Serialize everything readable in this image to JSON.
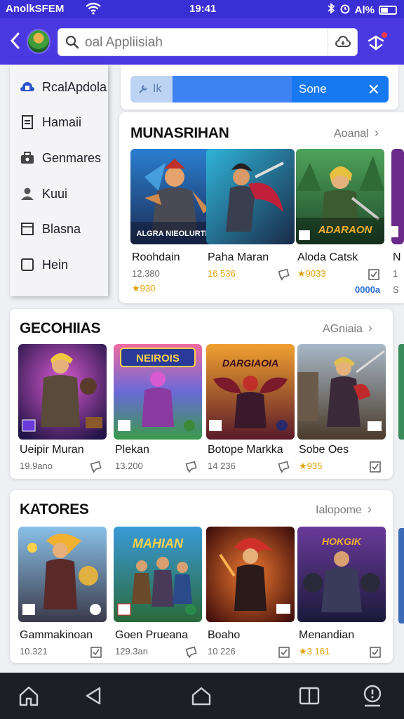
{
  "status": {
    "carrier": "AnolkSFEM",
    "time": "19:41",
    "battery": "Al%"
  },
  "header": {
    "search_placeholder": "oal Appliisiah"
  },
  "drawer": {
    "items": [
      {
        "label": "RcalApdola",
        "icon": "cloud-lock-icon"
      },
      {
        "label": "Hamaii",
        "icon": "document-icon"
      },
      {
        "label": "Genmares",
        "icon": "briefcase-icon"
      },
      {
        "label": "Kuui",
        "icon": "user-icon"
      },
      {
        "label": "Blasna",
        "icon": "square-icon"
      },
      {
        "label": "Hein",
        "icon": "checkbox-icon"
      }
    ]
  },
  "filter": {
    "left_label": "Ik",
    "right_label": "Sone"
  },
  "sections": [
    {
      "title": "MUNASRIHAN",
      "more": "Aoanal",
      "cards": [
        {
          "name": "Roohdain",
          "meta1": "12.380",
          "meta2": "★930"
        },
        {
          "name": "Paha Maran",
          "meta1": "16 536",
          "meta2": ""
        },
        {
          "name": "Aloda Catsk",
          "meta1": "★9033",
          "meta2": ""
        },
        {
          "name": "N",
          "meta1": "1",
          "meta2": "S"
        }
      ],
      "badge": "0000a"
    },
    {
      "title": "GECOHIIAS",
      "more": "AGniaia",
      "cards": [
        {
          "name": "Ueipir Muran",
          "meta1": "19.9ano",
          "meta2": ""
        },
        {
          "name": "Plekan",
          "meta1": "13.200",
          "meta2": ""
        },
        {
          "name": "Botope Markka",
          "meta1": "14 236",
          "meta2": ""
        },
        {
          "name": "Sobe Oes",
          "meta1": "★935",
          "meta2": ""
        }
      ]
    },
    {
      "title": "KATORES",
      "more": "Ialopome",
      "cards": [
        {
          "name": "Gammakinoan",
          "meta1": "10.321",
          "meta2": ""
        },
        {
          "name": "Goen Prueana",
          "meta1": "129.3an",
          "meta2": ""
        },
        {
          "name": "Boaho",
          "meta1": "10 226",
          "meta2": ""
        },
        {
          "name": "Menandian",
          "meta1": "★3 161",
          "meta2": ""
        }
      ]
    }
  ],
  "thumb_banners": {
    "s1c1": "ALGRA NIEOLURTIA",
    "s1c3": "ADARAON",
    "s2c2": "NEIROIS",
    "s2c3": "DARGIAOIA",
    "s3c2": "MAHIAN",
    "s3c4": "HOKGIK"
  },
  "colors": {
    "accent": "#4a38e0",
    "status": "#3a2fd4",
    "navbar": "#1e1f24"
  }
}
